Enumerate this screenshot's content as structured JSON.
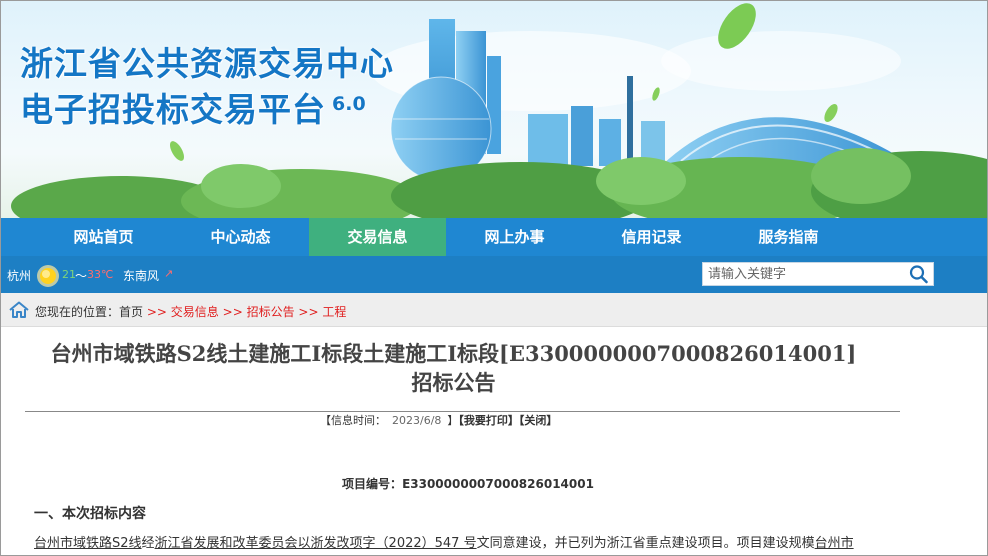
{
  "banner": {
    "title_line1": "浙江省公共资源交易中心",
    "title_line2": "电子招投标交易平台",
    "version": "6.0"
  },
  "nav": {
    "items": [
      "网站首页",
      "中心动态",
      "交易信息",
      "网上办事",
      "信用记录",
      "服务指南"
    ],
    "active": "交易信息"
  },
  "weather": {
    "city": "杭州",
    "icon": "sun-icon",
    "temp_low": "21",
    "temp_sep": "～",
    "temp_high": "33℃",
    "wind": "东南风",
    "wind_arrow": "↗"
  },
  "search": {
    "placeholder": "请输入关键字",
    "icon": "search-icon"
  },
  "breadcrumb": {
    "prefix": "您现在的位置：",
    "home": "首页",
    "separator": ">>",
    "items": [
      "交易信息",
      "招标公告",
      "工程"
    ]
  },
  "article": {
    "title_line1": "台州市域铁路S2线土建施工Ⅰ标段土建施工Ⅰ标段[E3300000007000826014001]",
    "title_line2": "招标公告",
    "meta_label": "【信息时间：",
    "meta_date": "2023/6/8",
    "meta_close_bracket": "】",
    "print_label": "【我要打印】",
    "close_label": "【关闭】",
    "project_no_label": "项目编号：",
    "project_no": "E3300000007000826014001",
    "section1_heading": "一、本次招标内容",
    "body_part1": "台州市域铁路S2线",
    "body_part2": "经",
    "body_part3": "浙江省发展和改革委员会以浙发改项字（2022）547 号",
    "body_part4": "文同意建设，并已列为浙江省重点建设项目。项目建设规模",
    "body_part5": "台州市"
  },
  "colors": {
    "nav_bg": "#1f87d2",
    "nav_active": "#3fb07f",
    "infobar_bg": "#1d7fc4",
    "title_blue": "#1476c5",
    "link_red": "#e02020"
  }
}
